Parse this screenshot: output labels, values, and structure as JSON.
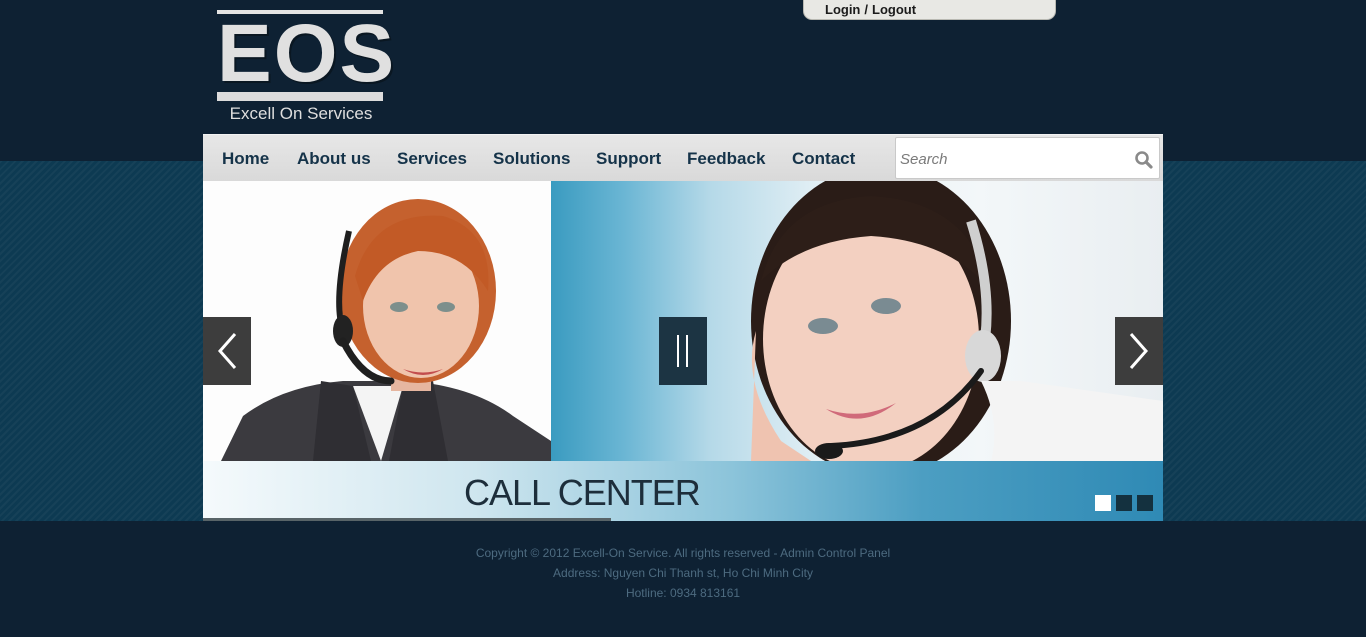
{
  "logo": {
    "word": "EOS",
    "subtitle": "Excell On Services"
  },
  "auth": {
    "login": "Login",
    "separator": "/",
    "logout": "Logout"
  },
  "nav": {
    "items": [
      {
        "label": "Home"
      },
      {
        "label": "About us"
      },
      {
        "label": "Services"
      },
      {
        "label": "Solutions"
      },
      {
        "label": "Support"
      },
      {
        "label": "Feedback"
      },
      {
        "label": "Contact"
      }
    ]
  },
  "search": {
    "placeholder": "Search",
    "icon": "magnifier-icon"
  },
  "slider": {
    "caption": "CALL CENTER",
    "progress": 0.425,
    "slide_count": 3,
    "active_slide": 1,
    "colors": {
      "active_dot": "#ffffff",
      "inactive_dot": "#14313f",
      "arrow_bg": "#3d3d3d",
      "pause_bg": "#1c3443"
    }
  },
  "footer": {
    "copyright": "Copyright © 2012 Excell-On Service. All rights reserved - Admin Control Panel",
    "address": "Address: Nguyen Chi Thanh st, Ho Chi Minh City",
    "hotline": "Hotline: 0934 813161"
  },
  "colors": {
    "page_bg": "#0e2133",
    "band_bg": "#0d3a52",
    "nav_text": "#153349",
    "footer_text": "#4d6b80"
  }
}
